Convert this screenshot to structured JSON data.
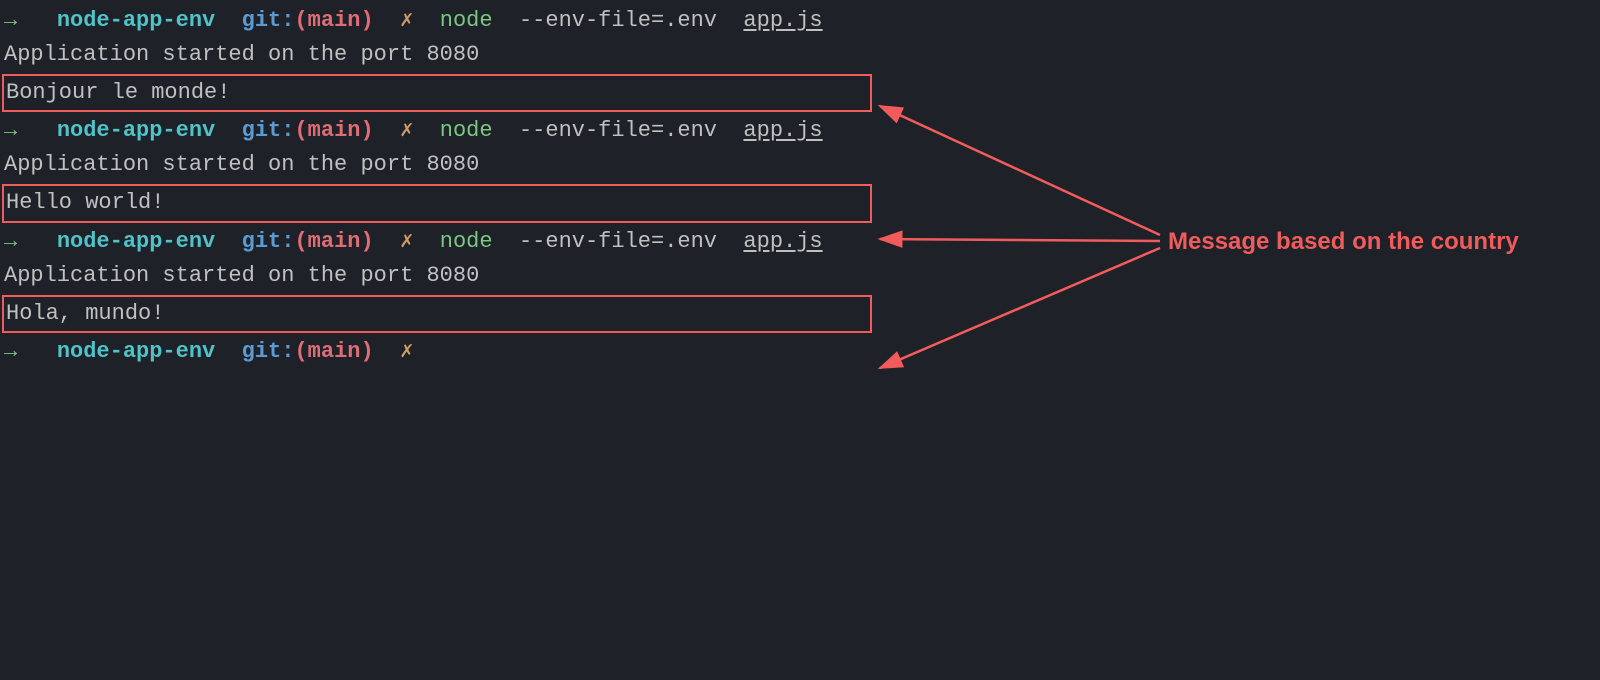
{
  "prompt": {
    "arrow": "→",
    "dir": "node-app-env",
    "git_prefix": "git:",
    "paren_open": "(",
    "branch": "main",
    "paren_close": ")",
    "dirty_mark": "✗"
  },
  "command": {
    "runtime": "node",
    "flag": "--env-file=.env",
    "script": "app.js"
  },
  "runs": [
    {
      "startup": "Application started on the port 8080",
      "message": "Bonjour le monde!"
    },
    {
      "startup": "Application started on the port 8080",
      "message": "Hello world!"
    },
    {
      "startup": "Application started on the port 8080",
      "message": "Hola, mundo!"
    }
  ],
  "annotation": {
    "label": "Message based on the country"
  }
}
